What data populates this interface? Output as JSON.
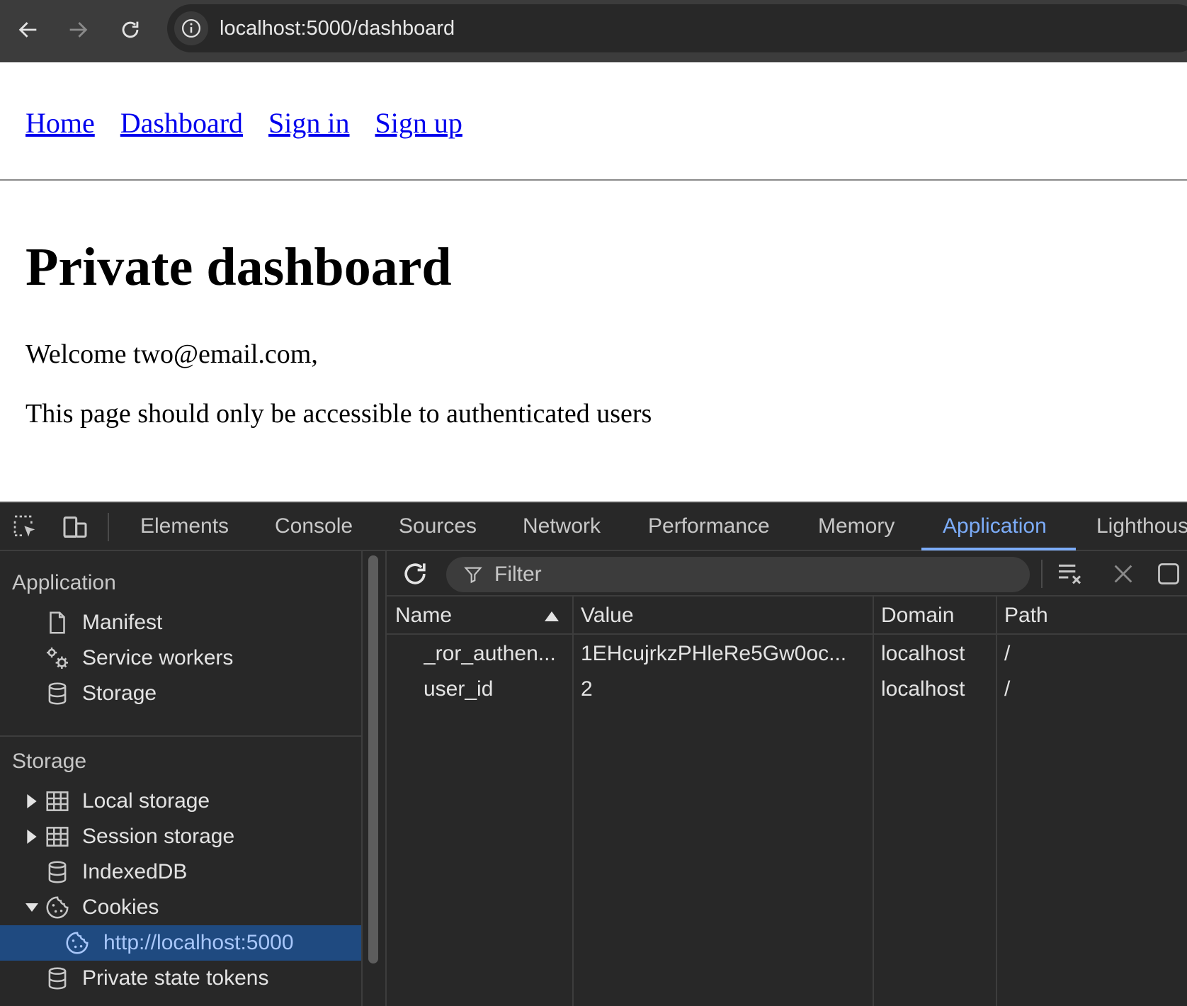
{
  "browser": {
    "url": "localhost:5000/dashboard"
  },
  "page": {
    "nav": [
      "Home",
      "Dashboard",
      "Sign in",
      "Sign up"
    ],
    "title": "Private dashboard",
    "welcome": "Welcome two@email.com,",
    "notice": "This page should only be accessible to authenticated users"
  },
  "devtools": {
    "tabs": [
      "Elements",
      "Console",
      "Sources",
      "Network",
      "Performance",
      "Memory",
      "Application",
      "Lighthous"
    ],
    "active_tab": "Application",
    "sidebar": {
      "application_heading": "Application",
      "application_items": [
        "Manifest",
        "Service workers",
        "Storage"
      ],
      "storage_heading": "Storage",
      "storage_items": [
        "Local storage",
        "Session storage",
        "IndexedDB",
        "Cookies",
        "http://localhost:5000",
        "Private state tokens"
      ]
    },
    "filter_placeholder": "Filter",
    "columns": [
      "Name",
      "Value",
      "Domain",
      "Path"
    ],
    "rows": [
      {
        "name": "_ror_authen...",
        "value": "1EHcujrkzPHleRe5Gw0oc...",
        "domain": "localhost",
        "path": "/"
      },
      {
        "name": "user_id",
        "value": "2",
        "domain": "localhost",
        "path": "/"
      }
    ],
    "accent_color": "#7cacf8",
    "selected_bg": "#1f4a80"
  }
}
